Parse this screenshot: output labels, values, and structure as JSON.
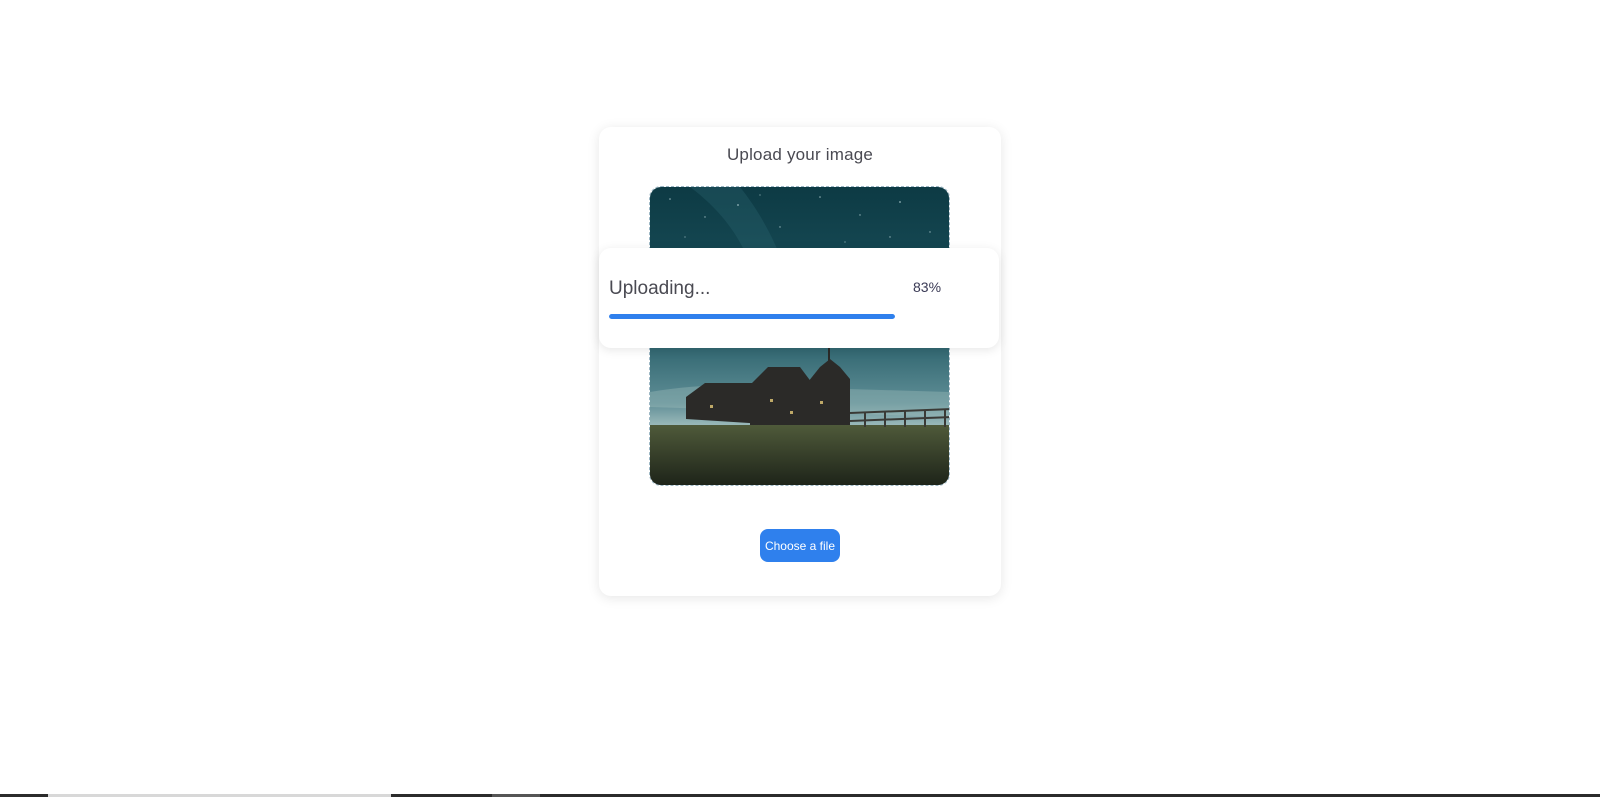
{
  "card": {
    "title": "Upload your image",
    "choose_button_label": "Choose a file"
  },
  "upload": {
    "status_label": "Uploading...",
    "percent_label": "83%",
    "progress": 0.83
  },
  "colors": {
    "accent": "#2f80ed",
    "text": "#4a4a52"
  }
}
